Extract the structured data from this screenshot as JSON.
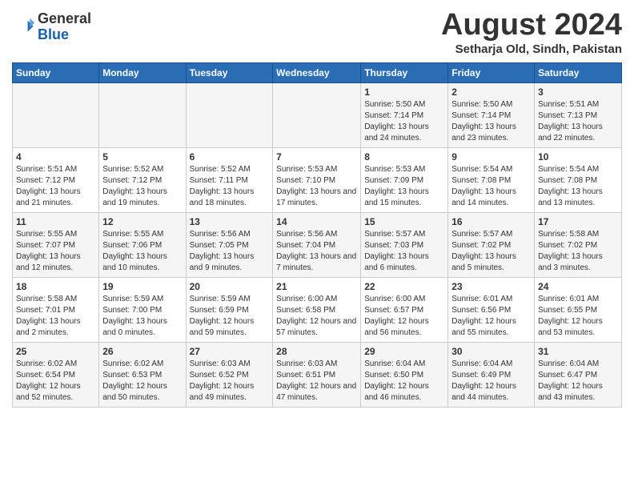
{
  "header": {
    "logo": {
      "general": "General",
      "blue": "Blue"
    },
    "title": "August 2024",
    "location": "Setharja Old, Sindh, Pakistan"
  },
  "calendar": {
    "weekdays": [
      "Sunday",
      "Monday",
      "Tuesday",
      "Wednesday",
      "Thursday",
      "Friday",
      "Saturday"
    ],
    "weeks": [
      [
        {
          "day": "",
          "data": ""
        },
        {
          "day": "",
          "data": ""
        },
        {
          "day": "",
          "data": ""
        },
        {
          "day": "",
          "data": ""
        },
        {
          "day": "1",
          "data": "Sunrise: 5:50 AM\nSunset: 7:14 PM\nDaylight: 13 hours and 24 minutes."
        },
        {
          "day": "2",
          "data": "Sunrise: 5:50 AM\nSunset: 7:14 PM\nDaylight: 13 hours and 23 minutes."
        },
        {
          "day": "3",
          "data": "Sunrise: 5:51 AM\nSunset: 7:13 PM\nDaylight: 13 hours and 22 minutes."
        }
      ],
      [
        {
          "day": "4",
          "data": "Sunrise: 5:51 AM\nSunset: 7:12 PM\nDaylight: 13 hours and 21 minutes."
        },
        {
          "day": "5",
          "data": "Sunrise: 5:52 AM\nSunset: 7:12 PM\nDaylight: 13 hours and 19 minutes."
        },
        {
          "day": "6",
          "data": "Sunrise: 5:52 AM\nSunset: 7:11 PM\nDaylight: 13 hours and 18 minutes."
        },
        {
          "day": "7",
          "data": "Sunrise: 5:53 AM\nSunset: 7:10 PM\nDaylight: 13 hours and 17 minutes."
        },
        {
          "day": "8",
          "data": "Sunrise: 5:53 AM\nSunset: 7:09 PM\nDaylight: 13 hours and 15 minutes."
        },
        {
          "day": "9",
          "data": "Sunrise: 5:54 AM\nSunset: 7:08 PM\nDaylight: 13 hours and 14 minutes."
        },
        {
          "day": "10",
          "data": "Sunrise: 5:54 AM\nSunset: 7:08 PM\nDaylight: 13 hours and 13 minutes."
        }
      ],
      [
        {
          "day": "11",
          "data": "Sunrise: 5:55 AM\nSunset: 7:07 PM\nDaylight: 13 hours and 12 minutes."
        },
        {
          "day": "12",
          "data": "Sunrise: 5:55 AM\nSunset: 7:06 PM\nDaylight: 13 hours and 10 minutes."
        },
        {
          "day": "13",
          "data": "Sunrise: 5:56 AM\nSunset: 7:05 PM\nDaylight: 13 hours and 9 minutes."
        },
        {
          "day": "14",
          "data": "Sunrise: 5:56 AM\nSunset: 7:04 PM\nDaylight: 13 hours and 7 minutes."
        },
        {
          "day": "15",
          "data": "Sunrise: 5:57 AM\nSunset: 7:03 PM\nDaylight: 13 hours and 6 minutes."
        },
        {
          "day": "16",
          "data": "Sunrise: 5:57 AM\nSunset: 7:02 PM\nDaylight: 13 hours and 5 minutes."
        },
        {
          "day": "17",
          "data": "Sunrise: 5:58 AM\nSunset: 7:02 PM\nDaylight: 13 hours and 3 minutes."
        }
      ],
      [
        {
          "day": "18",
          "data": "Sunrise: 5:58 AM\nSunset: 7:01 PM\nDaylight: 13 hours and 2 minutes."
        },
        {
          "day": "19",
          "data": "Sunrise: 5:59 AM\nSunset: 7:00 PM\nDaylight: 13 hours and 0 minutes."
        },
        {
          "day": "20",
          "data": "Sunrise: 5:59 AM\nSunset: 6:59 PM\nDaylight: 12 hours and 59 minutes."
        },
        {
          "day": "21",
          "data": "Sunrise: 6:00 AM\nSunset: 6:58 PM\nDaylight: 12 hours and 57 minutes."
        },
        {
          "day": "22",
          "data": "Sunrise: 6:00 AM\nSunset: 6:57 PM\nDaylight: 12 hours and 56 minutes."
        },
        {
          "day": "23",
          "data": "Sunrise: 6:01 AM\nSunset: 6:56 PM\nDaylight: 12 hours and 55 minutes."
        },
        {
          "day": "24",
          "data": "Sunrise: 6:01 AM\nSunset: 6:55 PM\nDaylight: 12 hours and 53 minutes."
        }
      ],
      [
        {
          "day": "25",
          "data": "Sunrise: 6:02 AM\nSunset: 6:54 PM\nDaylight: 12 hours and 52 minutes."
        },
        {
          "day": "26",
          "data": "Sunrise: 6:02 AM\nSunset: 6:53 PM\nDaylight: 12 hours and 50 minutes."
        },
        {
          "day": "27",
          "data": "Sunrise: 6:03 AM\nSunset: 6:52 PM\nDaylight: 12 hours and 49 minutes."
        },
        {
          "day": "28",
          "data": "Sunrise: 6:03 AM\nSunset: 6:51 PM\nDaylight: 12 hours and 47 minutes."
        },
        {
          "day": "29",
          "data": "Sunrise: 6:04 AM\nSunset: 6:50 PM\nDaylight: 12 hours and 46 minutes."
        },
        {
          "day": "30",
          "data": "Sunrise: 6:04 AM\nSunset: 6:49 PM\nDaylight: 12 hours and 44 minutes."
        },
        {
          "day": "31",
          "data": "Sunrise: 6:04 AM\nSunset: 6:47 PM\nDaylight: 12 hours and 43 minutes."
        }
      ]
    ]
  }
}
